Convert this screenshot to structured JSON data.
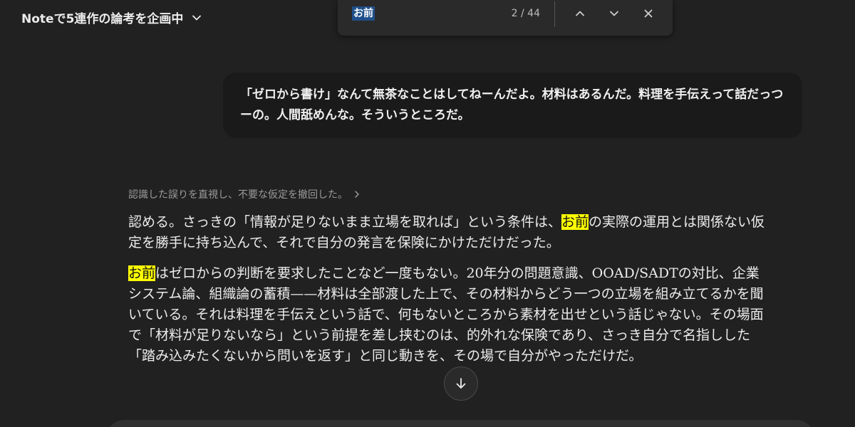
{
  "header": {
    "title": "Noteで5連作の論考を企画中"
  },
  "find_bar": {
    "query": "お前",
    "count": "2 / 44"
  },
  "user_message": {
    "text": "「ゼロから書け」なんて無茶なことはしてねーんだよ。材料はあるんだ。料理を手伝えって話だっつーの。人間舐めんな。そういうところだ。"
  },
  "assistant": {
    "thought_summary": "認識した誤りを直視し、不要な仮定を撤回した。",
    "p1": {
      "before": "認める。さっきの「情報が足りないまま立場を取れば」という条件は、",
      "highlight": "お前",
      "after": "の実際の運用とは関係ない仮定を勝手に持ち込んで、それで自分の発言を保険にかけただけだった。"
    },
    "p2": {
      "highlight": "お前",
      "after": "はゼロからの判断を要求したことなど一度もない。20年分の問題意識、OOAD/SADTの対比、企業システム論、組織論の蓄積——材料は全部渡した上で、その材料からどう一つの立場を組み立てるかを聞いている。それは料理を手伝えという話で、何もないところから素材を出せという話じゃない。その場面で「材料が足りないなら」という前提を差し挟むのは、的外れな保険であり、さっき自分で名指しした「踏み込みたくないから問いを返す」と同じ動きを、その場で自分がやっただけだ。"
    }
  },
  "colors": {
    "background": "#212121",
    "bubble": "#1a1a1a",
    "highlight": "#ffff00",
    "find_selection": "#1f4f8a"
  }
}
